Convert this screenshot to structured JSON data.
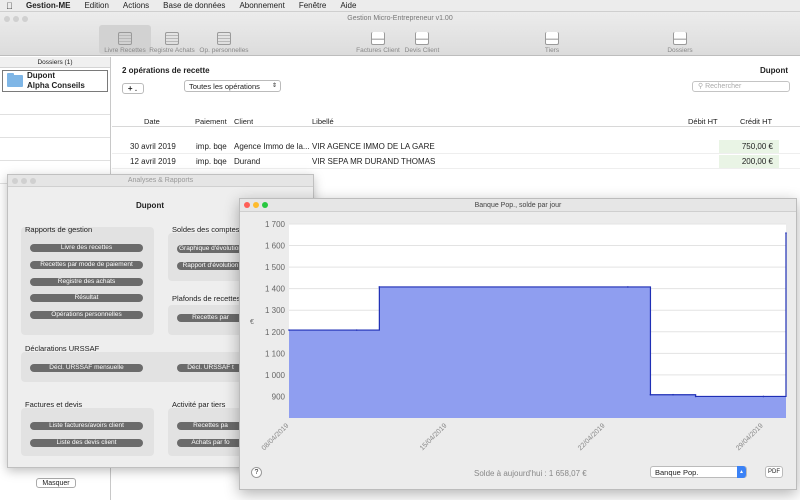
{
  "menubar": {
    "app": "Gestion-ME",
    "items": [
      "Edition",
      "Actions",
      "Base de données",
      "Abonnement",
      "Fenêtre",
      "Aide"
    ]
  },
  "window": {
    "title": "Gestion Micro-Entrepreneur v1.00"
  },
  "toolbar": {
    "livre_recettes": "Livre Recettes",
    "registre_achats": "Registre Achats",
    "op_personnelles": "Op. personnelles",
    "factures_client": "Factures Client",
    "devis_client": "Devis Client",
    "tiers": "Tiers",
    "dossiers": "Dossiers"
  },
  "sidebar": {
    "header": "Dossiers (1)",
    "dossier_name": "Dupont",
    "dossier_sub": "Alpha Conseils",
    "hide_button": "Masquer"
  },
  "main": {
    "heading": "2 opérations de recette",
    "owner": "Dupont",
    "add_button": "+",
    "filter": "Toutes les opérations",
    "search_placeholder": "Rechercher",
    "columns": {
      "date": "Date",
      "paiement": "Paiement",
      "client": "Client",
      "libelle": "Libellé",
      "debit": "Débit HT",
      "credit": "Crédit HT"
    },
    "rows": [
      {
        "date": "30 avril 2019",
        "paiement": "imp. bqe",
        "client": "Agence Immo de la...",
        "libelle": "VIR AGENCE IMMO DE LA GARE",
        "debit": "",
        "credit": "750,00 €"
      },
      {
        "date": "12 avril 2019",
        "paiement": "imp. bqe",
        "client": "Durand",
        "libelle": "VIR SEPA MR DURAND THOMAS",
        "debit": "",
        "credit": "200,00 €"
      }
    ]
  },
  "analyses": {
    "title": "Analyses & Rapports",
    "owner": "Dupont",
    "rapports_title": "Rapports de gestion",
    "rapports": [
      "Livre des recettes",
      "Recettes par mode de paiement",
      "Registre des achats",
      "Résultat",
      "Opérations personnelles"
    ],
    "soldes_title": "Soldes des comptes",
    "soldes": [
      "Graphique d'évolution",
      "Rapport d'évolution"
    ],
    "plafonds_title": "Plafonds de recettes",
    "plafonds": [
      "Recettes par"
    ],
    "urssaf_title": "Déclarations URSSAF",
    "urssaf": [
      "Décl. URSSAF mensuelle",
      "Décl. URSSAF t"
    ],
    "factures_title": "Factures et devis",
    "factures": [
      "Liste factures/avoirs client",
      "Liste des devis client"
    ],
    "activite_title": "Activité par tiers",
    "activite": [
      "Recettes pa",
      "Achats par fo"
    ]
  },
  "chart_window": {
    "title": "Banque Pop., solde par jour",
    "help": "?",
    "solde_text": "Solde à aujourd'hui : 1 658,07 €",
    "bank_select": "Banque Pop.",
    "pdf_button": "PDF"
  },
  "chart_data": {
    "type": "area",
    "title": "Banque Pop., solde par jour",
    "ylabel": "€",
    "ylim": [
      800,
      1700
    ],
    "yticks": [
      "900",
      "1 000",
      "1 100",
      "1 200",
      "1 300",
      "1 400",
      "1 500",
      "1 600",
      "1 700"
    ],
    "xticks": [
      "08/04/2019",
      "15/04/2019",
      "22/04/2019",
      "29/04/2019"
    ],
    "grid": true,
    "fill_color": "#8f9ef0",
    "line_color": "#1f2fb5",
    "x": [
      "08/04/2019",
      "11/04/2019",
      "12/04/2019",
      "23/04/2019",
      "24/04/2019",
      "25/04/2019",
      "26/04/2019",
      "29/04/2019",
      "30/04/2019"
    ],
    "values": [
      1208,
      1208,
      1408,
      1408,
      908,
      908,
      900,
      900,
      1658
    ]
  }
}
